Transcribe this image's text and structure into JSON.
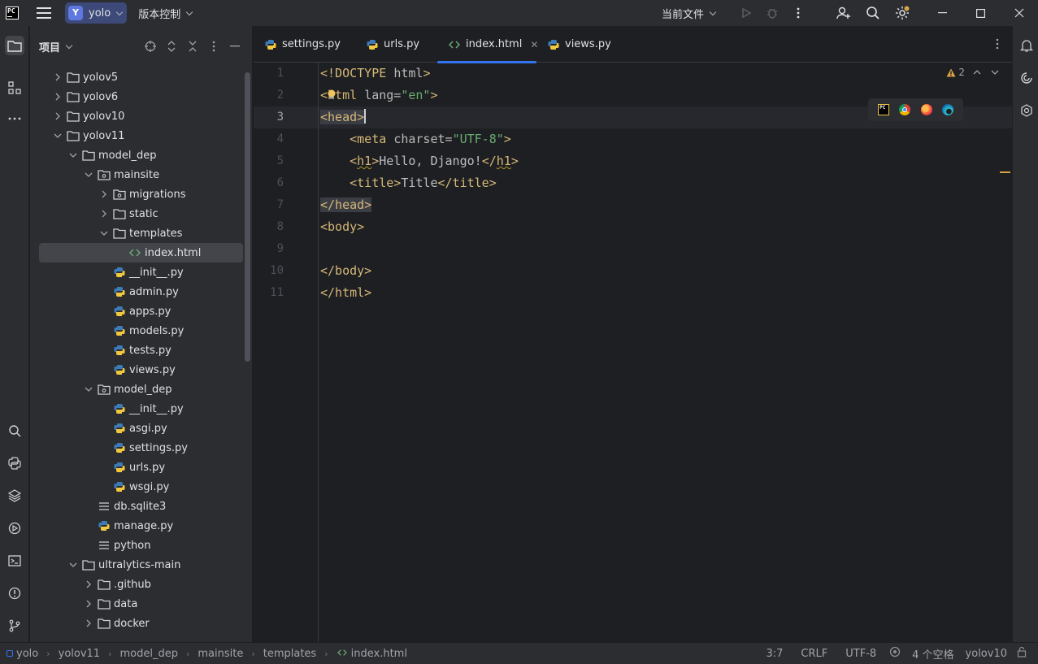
{
  "titlebar": {
    "project_badge": "Y",
    "project_name": "yolo",
    "vcs_label": "版本控制",
    "run_config": "当前文件"
  },
  "project_panel": {
    "title": "项目",
    "tree": [
      {
        "label": "yolov5",
        "type": "folder",
        "expanded": false
      },
      {
        "label": "yolov6",
        "type": "folder",
        "expanded": false
      },
      {
        "label": "yolov10",
        "type": "folder",
        "expanded": false
      },
      {
        "label": "yolov11",
        "type": "folder",
        "expanded": true
      },
      {
        "label": "model_dep",
        "type": "folder",
        "expanded": true
      },
      {
        "label": "mainsite",
        "type": "module",
        "expanded": true
      },
      {
        "label": "migrations",
        "type": "module",
        "expanded": false
      },
      {
        "label": "static",
        "type": "folder",
        "expanded": false
      },
      {
        "label": "templates",
        "type": "folder",
        "expanded": true
      },
      {
        "label": "index.html",
        "type": "html",
        "selected": true
      },
      {
        "label": "__init__.py",
        "type": "python"
      },
      {
        "label": "admin.py",
        "type": "python"
      },
      {
        "label": "apps.py",
        "type": "python"
      },
      {
        "label": "models.py",
        "type": "python"
      },
      {
        "label": "tests.py",
        "type": "python"
      },
      {
        "label": "views.py",
        "type": "python"
      },
      {
        "label": "model_dep",
        "type": "module",
        "expanded": true
      },
      {
        "label": "__init__.py",
        "type": "python"
      },
      {
        "label": "asgi.py",
        "type": "python"
      },
      {
        "label": "settings.py",
        "type": "python"
      },
      {
        "label": "urls.py",
        "type": "python"
      },
      {
        "label": "wsgi.py",
        "type": "python"
      },
      {
        "label": "db.sqlite3",
        "type": "text"
      },
      {
        "label": "manage.py",
        "type": "python"
      },
      {
        "label": "python",
        "type": "text"
      },
      {
        "label": "ultralytics-main",
        "type": "folder",
        "expanded": true
      },
      {
        "label": ".github",
        "type": "folder",
        "expanded": false
      },
      {
        "label": "data",
        "type": "folder",
        "expanded": false
      },
      {
        "label": "docker",
        "type": "folder",
        "expanded": false
      }
    ]
  },
  "editor": {
    "tabs": [
      {
        "label": "settings.py",
        "type": "python",
        "active": false
      },
      {
        "label": "urls.py",
        "type": "python",
        "active": false
      },
      {
        "label": "index.html",
        "type": "html",
        "active": true
      },
      {
        "label": "views.py",
        "type": "python",
        "active": false
      }
    ],
    "warning_count": "2",
    "line_numbers": [
      "1",
      "2",
      "3",
      "4",
      "5",
      "6",
      "7",
      "8",
      "9",
      "10",
      "11"
    ],
    "current_line": "3",
    "code": [
      "<!DOCTYPE html>",
      "<html lang=\"en\">",
      "<head>",
      "    <meta charset=\"UTF-8\">",
      "    <h1>Hello, Django!</h1>",
      "    <title>Title</title>",
      "</head>",
      "<body>",
      "",
      "</body>",
      "</html>"
    ]
  },
  "statusbar": {
    "breadcrumbs": [
      "yolo",
      "yolov11",
      "model_dep",
      "mainsite",
      "templates",
      "index.html"
    ],
    "position": "3:7",
    "line_ending": "CRLF",
    "encoding": "UTF-8",
    "indent": "4 个空格",
    "interpreter": "yolov10"
  },
  "colors": {
    "accent": "#3574f0",
    "tag": "#d5b778",
    "string": "#6aab73",
    "warning": "#d9a343"
  }
}
